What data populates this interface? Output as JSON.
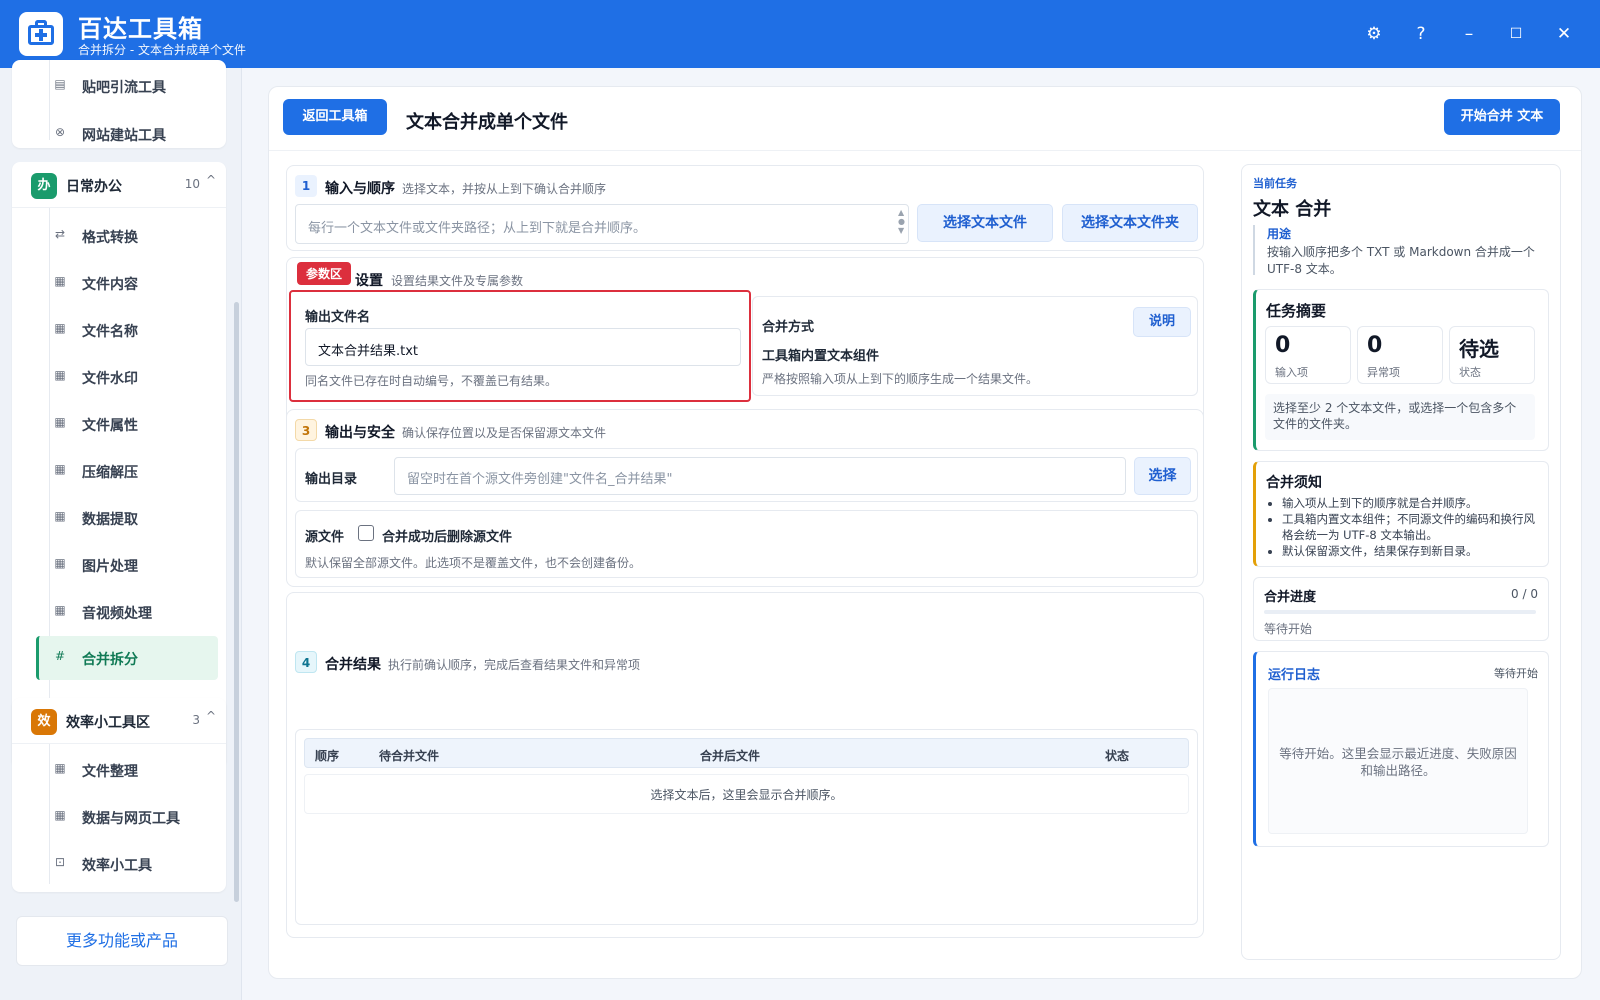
{
  "app": {
    "title": "百达工具箱",
    "subtitle": "合并拆分 - 文本合并成单个文件"
  },
  "window_controls": {
    "settings": "⚙",
    "help": "?",
    "minimize": "–",
    "maximize": "☐",
    "close": "✕"
  },
  "sidebar": {
    "top_items": [
      {
        "label": "贴吧引流工具",
        "icon": "document-icon"
      },
      {
        "label": "网站建站工具",
        "icon": "globe-icon"
      }
    ],
    "groups": [
      {
        "badge": "办",
        "badge_color": "#1a9b6c",
        "title": "日常办公",
        "count": "10",
        "items": [
          {
            "label": "格式转换",
            "icon": "swap-icon"
          },
          {
            "label": "文件内容",
            "icon": "grid-icon"
          },
          {
            "label": "文件名称",
            "icon": "grid-icon"
          },
          {
            "label": "文件水印",
            "icon": "grid-icon"
          },
          {
            "label": "文件属性",
            "icon": "grid-icon"
          },
          {
            "label": "压缩解压",
            "icon": "grid-icon"
          },
          {
            "label": "数据提取",
            "icon": "grid-icon"
          },
          {
            "label": "图片处理",
            "icon": "grid-icon"
          },
          {
            "label": "音视频处理",
            "icon": "grid-icon"
          },
          {
            "label": "合并拆分",
            "icon": "hash-icon",
            "active": true
          }
        ]
      },
      {
        "badge": "效",
        "badge_color": "#d97706",
        "title": "效率小工具区",
        "count": "3",
        "items": [
          {
            "label": "文件整理",
            "icon": "grid-icon"
          },
          {
            "label": "数据与网页工具",
            "icon": "grid-icon"
          },
          {
            "label": "效率小工具",
            "icon": "toolbox-icon"
          }
        ]
      }
    ],
    "more_label": "更多功能或产品"
  },
  "main": {
    "back_label": "返回工具箱",
    "title": "文本合并成单个文件",
    "start_label": "开始合并 文本",
    "sections": {
      "input": {
        "num": "1",
        "title": "输入与顺序",
        "desc": "选择文本，并按从上到下确认合并顺序",
        "placeholder": "每行一个文本文件或文件夹路径；从上到下就是合并顺序。",
        "btn_file": "选择文本文件",
        "btn_folder": "选择文本文件夹"
      },
      "params": {
        "tag": "参数区",
        "title": "设置",
        "desc": "设置结果文件及专属参数",
        "filename_label": "输出文件名",
        "filename_value": "文本合并结果.txt",
        "filename_hint": "同名文件已存在时自动编号，不覆盖已有结果。",
        "mode_label": "合并方式",
        "mode_help": "说明",
        "mode_value": "工具箱内置文本组件",
        "mode_hint": "严格按照输入项从上到下的顺序生成一个结果文件。"
      },
      "output": {
        "num": "3",
        "title": "输出与安全",
        "desc": "确认保存位置以及是否保留源文本文件",
        "dir_label": "输出目录",
        "dir_placeholder": "留空时在首个源文件旁创建\"文件名_合并结果\"",
        "dir_btn": "选择",
        "src_label": "源文件",
        "delete_label": "合并成功后删除源文件",
        "src_hint": "默认保留全部源文件。此选项不是覆盖文件，也不会创建备份。"
      },
      "result": {
        "num": "4",
        "title": "合并结果",
        "desc": "执行前确认顺序，完成后查看结果文件和异常项",
        "columns": [
          "顺序",
          "待合并文件",
          "合并后文件",
          "状态"
        ],
        "empty": "选择文本后，这里会显示合并顺序。"
      }
    }
  },
  "right": {
    "current_label": "当前任务",
    "task_title": "文本 合并",
    "usage_label": "用途",
    "usage_text": "按输入顺序把多个 TXT 或 Markdown 合并成一个 UTF-8 文本。",
    "summary_title": "任务摘要",
    "stats": [
      {
        "value": "0",
        "label": "输入项"
      },
      {
        "value": "0",
        "label": "异常项"
      },
      {
        "value": "待选",
        "label": "状态"
      }
    ],
    "summary_hint": "选择至少 2 个文本文件，或选择一个包含多个文件的文件夹。",
    "notice_title": "合并须知",
    "notice_items": [
      "输入项从上到下的顺序就是合并顺序。",
      "工具箱内置文本组件；不同源文件的编码和换行风格会统一为 UTF-8 文本输出。",
      "默认保留源文件，结果保存到新目录。"
    ],
    "progress_title": "合并进度",
    "progress_count": "0 / 0",
    "progress_fraction": 0,
    "progress_status": "等待开始",
    "log_title": "运行日志",
    "log_status": "等待开始",
    "log_empty": "等待开始。这里会显示最近进度、失败原因和输出路径。"
  }
}
